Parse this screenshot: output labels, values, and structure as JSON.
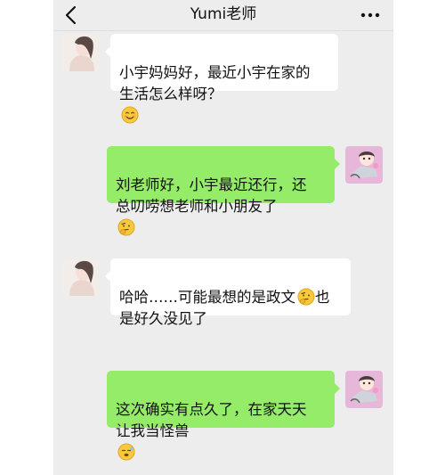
{
  "header": {
    "title": "Yumi老师",
    "back_icon": "chevron-left-icon",
    "more_icon": "more-dots-icon"
  },
  "colors": {
    "chat_background": "#ededed",
    "incoming_bubble": "#ffffff",
    "outgoing_bubble": "#95ec69"
  },
  "messages": [
    {
      "sender": "teacher",
      "text": "小宇妈妈好，最近小宇在家的\n生活怎么样呀？",
      "emoji": "smile-emoji-icon"
    },
    {
      "sender": "me",
      "text": "刘老师好，小宇最近还行，还\n总叨唠想老师和小朋友了",
      "emoji": "thinking-emoji-icon"
    },
    {
      "sender": "teacher",
      "text_line1": "哈哈……可能最想的是政文",
      "text_line2": "也\n是好久没见了",
      "emoji": "thinking-emoji-icon"
    },
    {
      "sender": "me",
      "text": "这次确实有点久了，在家天天\n让我当怪兽",
      "emoji": "sweat-emoji-icon"
    }
  ]
}
